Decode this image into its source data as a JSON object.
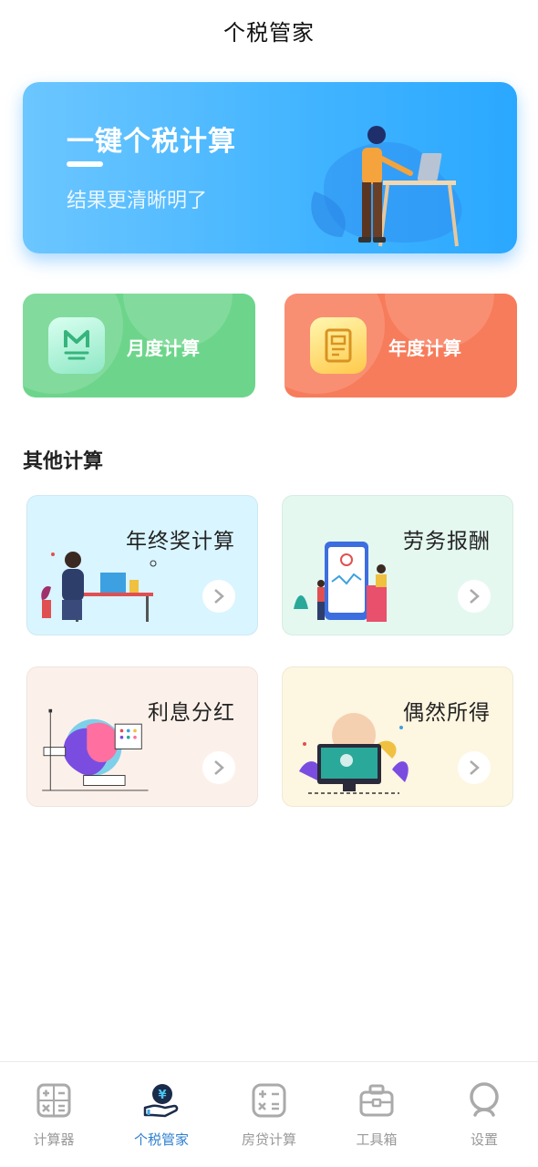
{
  "header": {
    "title": "个税管家"
  },
  "banner": {
    "title": "一键个税计算",
    "subtitle": "结果更清晰明了"
  },
  "quick_cards": [
    {
      "label": "月度计算",
      "icon": "m-letter-icon",
      "color": "#6dd58b"
    },
    {
      "label": "年度计算",
      "icon": "document-icon",
      "color": "#f77c5b"
    }
  ],
  "other_section": {
    "title": "其他计算",
    "items": [
      {
        "label": "年终奖计算",
        "icon": "chevron-right-icon"
      },
      {
        "label": "劳务报酬",
        "icon": "chevron-right-icon"
      },
      {
        "label": "利息分红",
        "icon": "chevron-right-icon"
      },
      {
        "label": "偶然所得",
        "icon": "chevron-right-icon"
      }
    ]
  },
  "tabbar": {
    "active_color": "#2f7fd1",
    "items": [
      {
        "label": "计算器",
        "icon": "calculator-icon",
        "active": false
      },
      {
        "label": "个税管家",
        "icon": "tax-hand-icon",
        "active": true
      },
      {
        "label": "房贷计算",
        "icon": "calculator-icon",
        "active": false
      },
      {
        "label": "工具箱",
        "icon": "toolbox-icon",
        "active": false
      },
      {
        "label": "设置",
        "icon": "settings-person-icon",
        "active": false
      }
    ]
  }
}
